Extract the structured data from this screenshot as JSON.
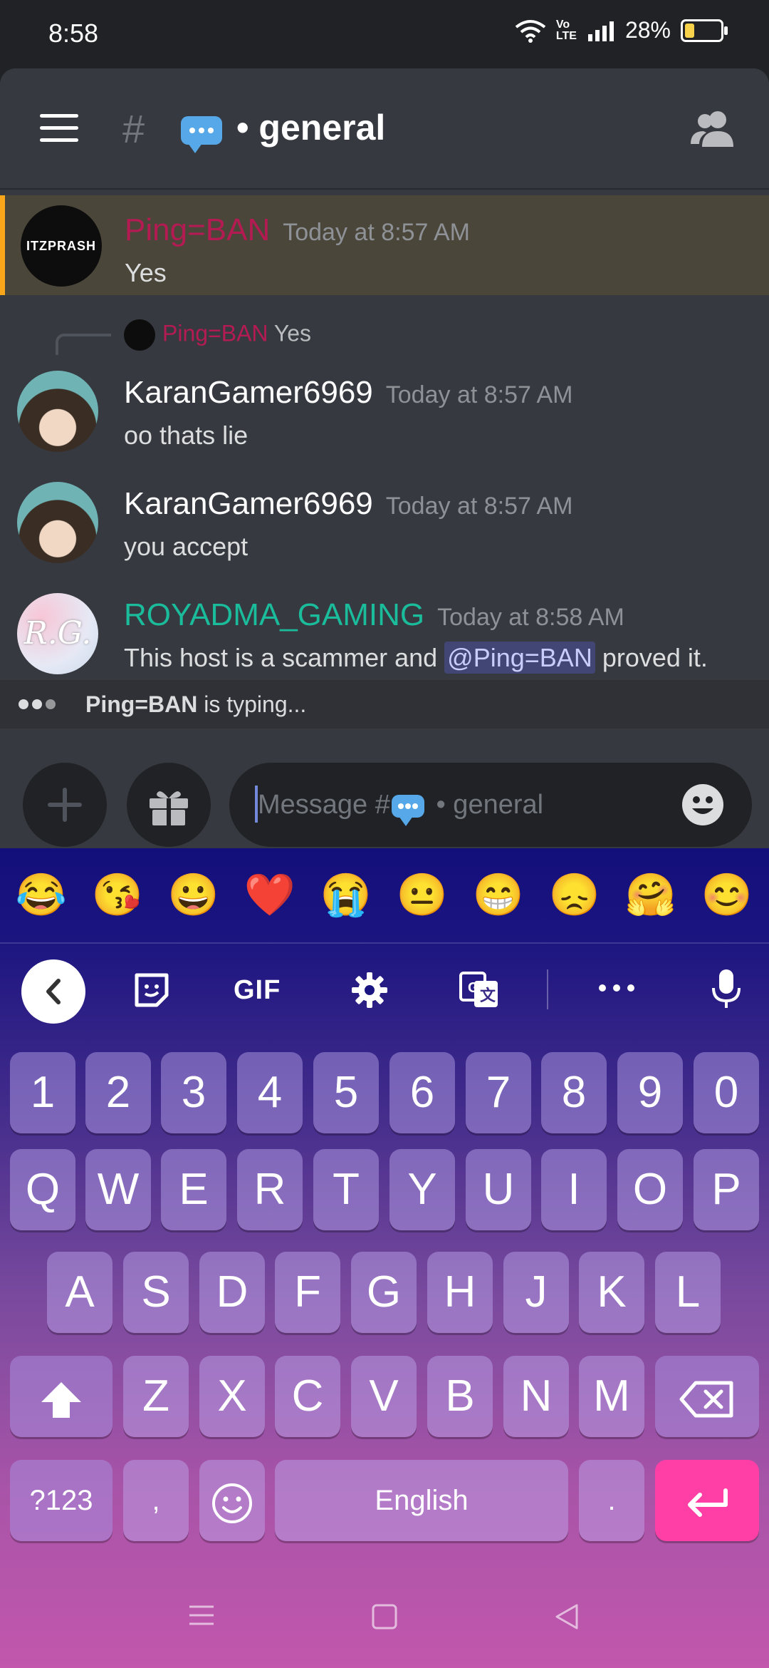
{
  "statusbar": {
    "time": "8:58",
    "network_label": "Vo\nLTE",
    "battery_percent": "28%",
    "battery_level": 0.28
  },
  "header": {
    "hash": "#",
    "channel_name": "general",
    "channel_bullet": "•"
  },
  "messages": [
    {
      "author": "Ping=BAN",
      "author_color": "#b31b52",
      "timestamp": "Today at 8:57 AM",
      "text": "Yes",
      "avatar_text": "ITZPRASH",
      "highlighted": true
    },
    {
      "reply_to_author": "Ping=BAN",
      "reply_to_text": "Yes",
      "author": "KaranGamer6969",
      "author_color": "#ffffff",
      "timestamp": "Today at 8:57 AM",
      "text": "oo thats lie"
    },
    {
      "author": "KaranGamer6969",
      "author_color": "#ffffff",
      "timestamp": "Today at 8:57 AM",
      "text": "you accept"
    },
    {
      "author": "ROYADMA_GAMING",
      "author_color": "#1abc9c",
      "timestamp": "Today at 8:58 AM",
      "text_before": "This host is a scammer and ",
      "mention": "@Ping=BAN",
      "text_after": " proved it.",
      "avatar_text": "R.G."
    }
  ],
  "typing": {
    "user": "Ping=BAN",
    "suffix": " is typing..."
  },
  "composer": {
    "placeholder_prefix": "Message #",
    "placeholder_suffix": " • general"
  },
  "keyboard": {
    "emoji_suggestions": [
      "😂",
      "😘",
      "😀",
      "❤️",
      "😭",
      "😐",
      "😁",
      "😞",
      "🤗",
      "😊"
    ],
    "tools": {
      "gif": "GIF"
    },
    "row_numbers": [
      "1",
      "2",
      "3",
      "4",
      "5",
      "6",
      "7",
      "8",
      "9",
      "0"
    ],
    "row1": [
      "Q",
      "W",
      "E",
      "R",
      "T",
      "Y",
      "U",
      "I",
      "O",
      "P"
    ],
    "row2": [
      "A",
      "S",
      "D",
      "F",
      "G",
      "H",
      "J",
      "K",
      "L"
    ],
    "row3": [
      "Z",
      "X",
      "C",
      "V",
      "B",
      "N",
      "M"
    ],
    "symbols_key": "?123",
    "comma_key": ",",
    "space_key": "English",
    "period_key": "."
  }
}
